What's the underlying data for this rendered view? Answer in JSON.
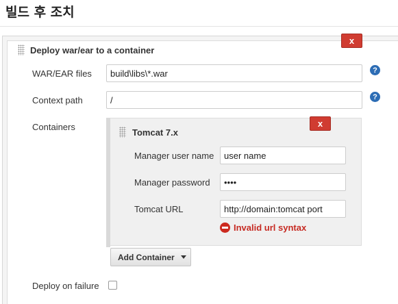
{
  "section": {
    "title": "빌드 후 조치"
  },
  "deploy": {
    "title": "Deploy war/ear to a container",
    "remove_label": "x",
    "war_ear_files": {
      "label": "WAR/EAR files",
      "value": "build\\libs\\*.war"
    },
    "context_path": {
      "label": "Context path",
      "value": "/"
    },
    "containers_label": "Containers",
    "help_label": "?",
    "deploy_on_failure": {
      "label": "Deploy on failure",
      "checked": false
    }
  },
  "container": {
    "title": "Tomcat 7.x",
    "remove_label": "x",
    "manager_user": {
      "label": "Manager user name",
      "value": "user name"
    },
    "manager_password": {
      "label": "Manager password",
      "value": "••••"
    },
    "tomcat_url": {
      "label": "Tomcat URL",
      "value": "http://domain:tomcat port"
    },
    "error": "Invalid url syntax"
  },
  "add_container": {
    "label": "Add Container"
  },
  "colors": {
    "danger": "#d03c31",
    "error_text": "#c62a22",
    "help": "#2d6db5"
  },
  "icons": [
    "drag-handle-icon",
    "help-icon",
    "error-icon",
    "caret-down-icon"
  ]
}
